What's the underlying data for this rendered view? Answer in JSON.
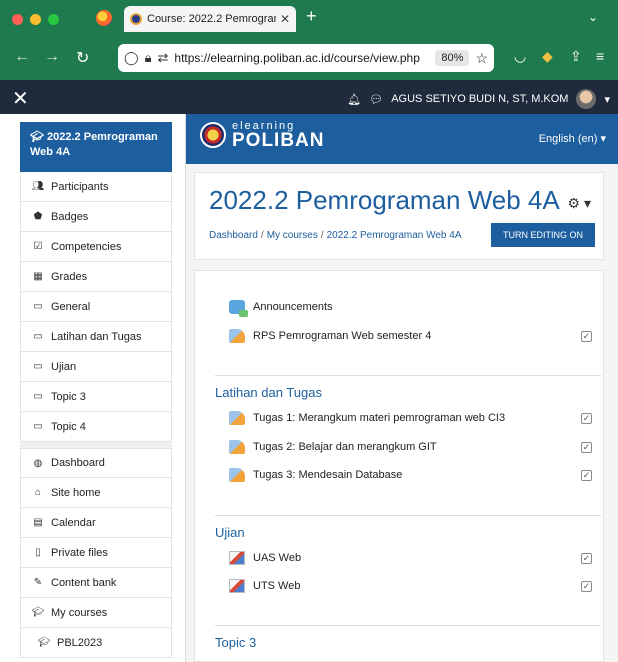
{
  "browser": {
    "tab_title": "Course: 2022.2 Pemrograman W",
    "url": "https://elearning.poliban.ac.id/course/view.php",
    "zoom": "80%"
  },
  "topbar": {
    "user_name": "AGUS SETIYO BUDI N, ST, M.KOM"
  },
  "drawer": {
    "course_name": "2022.2 Pemrograman Web 4A",
    "items": [
      {
        "label": "Participants",
        "icon": "users-icon"
      },
      {
        "label": "Badges",
        "icon": "badge-icon"
      },
      {
        "label": "Competencies",
        "icon": "competency-icon"
      },
      {
        "label": "Grades",
        "icon": "table-icon"
      },
      {
        "label": "General",
        "icon": "folder-icon"
      },
      {
        "label": "Latihan dan Tugas",
        "icon": "folder-icon"
      },
      {
        "label": "Ujian",
        "icon": "folder-icon"
      },
      {
        "label": "Topic 3",
        "icon": "folder-icon"
      },
      {
        "label": "Topic 4",
        "icon": "folder-icon"
      }
    ],
    "site_items": [
      {
        "label": "Dashboard",
        "icon": "dashboard-icon"
      },
      {
        "label": "Site home",
        "icon": "home-icon"
      },
      {
        "label": "Calendar",
        "icon": "calendar-icon"
      },
      {
        "label": "Private files",
        "icon": "file-icon"
      },
      {
        "label": "Content bank",
        "icon": "brush-icon"
      },
      {
        "label": "My courses",
        "icon": "graduation-cap-icon"
      },
      {
        "label": "PBL2023",
        "icon": "graduation-cap-icon"
      }
    ]
  },
  "banner": {
    "logo_small": "elearning",
    "logo_big": "POLIBAN",
    "language": "English (en)"
  },
  "header": {
    "title": "2022.2 Pemrograman Web 4A",
    "breadcrumb": [
      "Dashboard",
      "My courses",
      "2022.2 Pemrograman Web 4A"
    ],
    "edit_button": "TURN EDITING ON"
  },
  "sections": {
    "general": {
      "activities": [
        "Announcements",
        "RPS Pemrograman Web semester 4"
      ]
    },
    "latihan": {
      "title": "Latihan dan Tugas",
      "activities": [
        "Tugas 1: Merangkum materi pemrograman web CI3",
        "Tugas 2: Belajar dan merangkum GIT",
        "Tugas 3: Mendesain Database"
      ]
    },
    "ujian": {
      "title": "Ujian",
      "activities": [
        "UAS Web",
        "UTS Web"
      ]
    },
    "topic3": {
      "title": "Topic 3"
    }
  },
  "colors": {
    "browser_green": "#1f7a4d",
    "moodle_navbar": "#1f2a3c",
    "brand_blue": "#1c5e9e"
  }
}
